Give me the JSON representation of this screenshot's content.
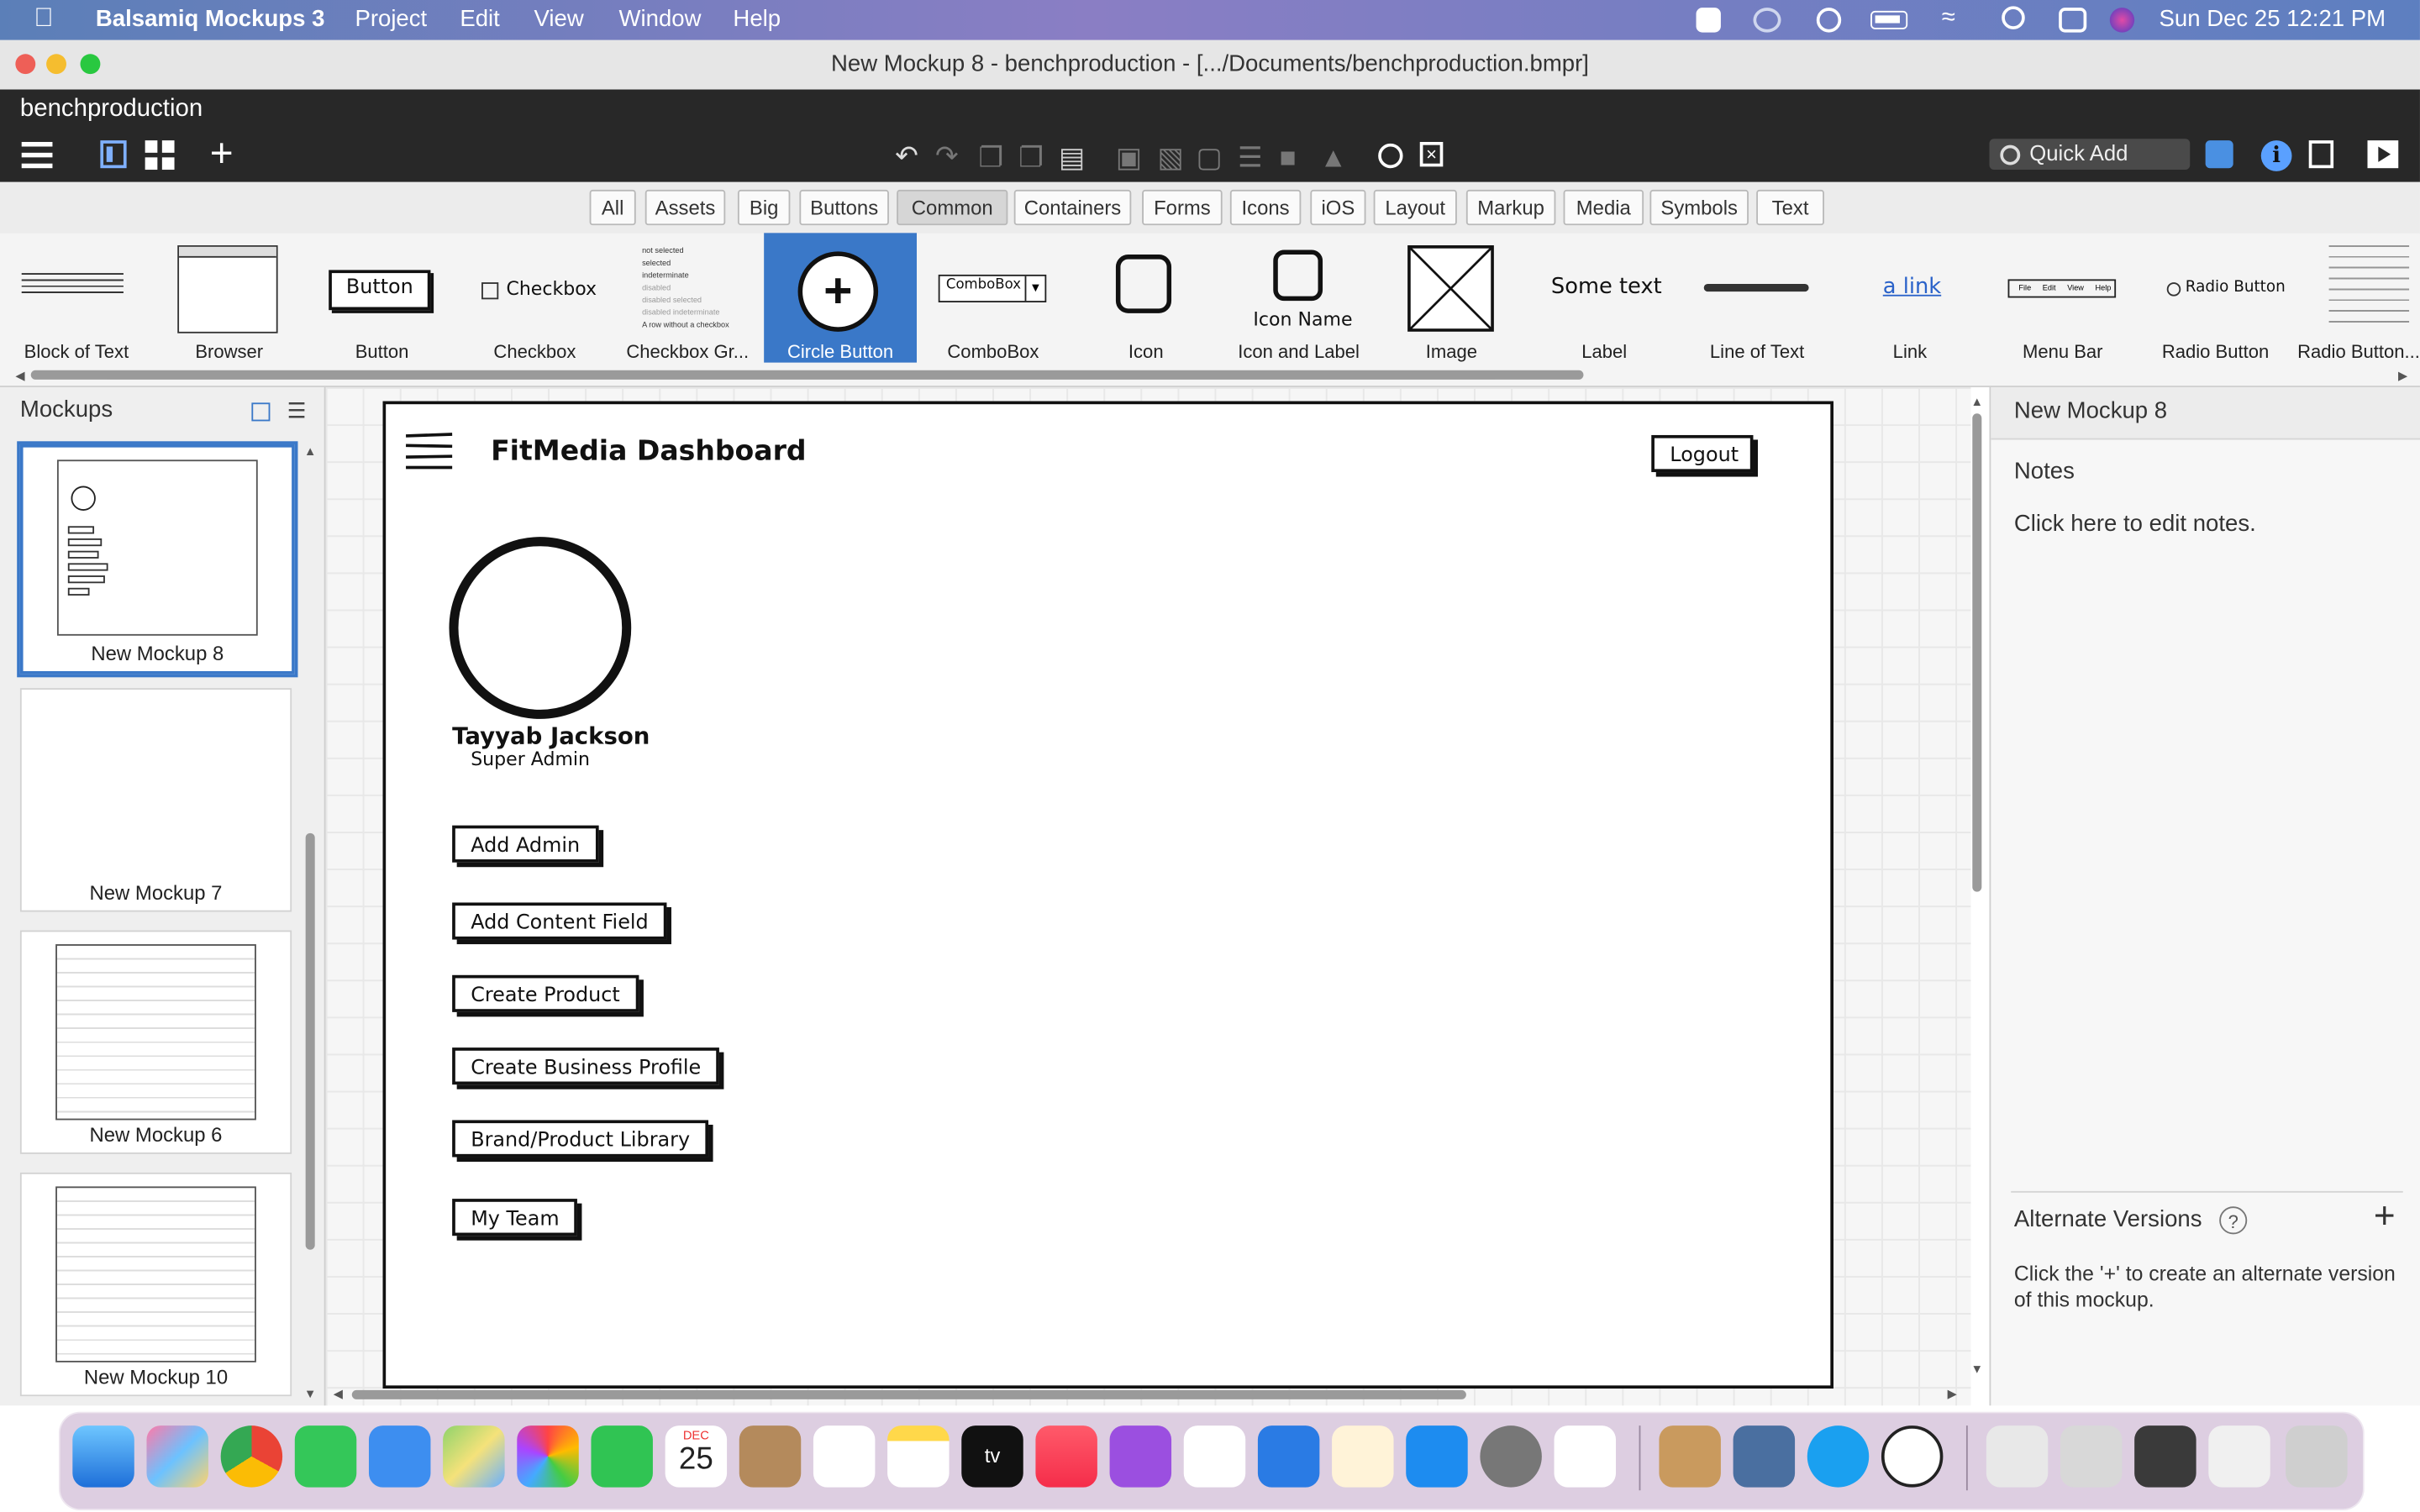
{
  "menubar": {
    "apple": "",
    "app_name": "Balsamiq Mockups 3",
    "items": [
      "Project",
      "Edit",
      "View",
      "Window",
      "Help"
    ],
    "clock": "Sun Dec 25  12:21 PM"
  },
  "window": {
    "title": "New Mockup 8 - benchproduction - [.../Documents/benchproduction.bmpr]",
    "project_name": "benchproduction"
  },
  "toolbar": {
    "quick_add_placeholder": "Quick Add"
  },
  "filter_tabs": [
    "All",
    "Assets",
    "Big",
    "Buttons",
    "Common",
    "Containers",
    "Forms",
    "Icons",
    "iOS",
    "Layout",
    "Markup",
    "Media",
    "Symbols",
    "Text"
  ],
  "filter_active": "Common",
  "library": {
    "items": [
      "Block of Text",
      "Browser",
      "Button",
      "Checkbox",
      "Checkbox Gr...",
      "Circle Button",
      "ComboBox",
      "Icon",
      "Icon and Label",
      "Image",
      "Label",
      "Line of Text",
      "Link",
      "Menu Bar",
      "Radio Button",
      "Radio Button..."
    ],
    "active": "Circle Button",
    "preview_button": "Button",
    "preview_checkbox": "Checkbox",
    "preview_combobox": "ComboBox",
    "preview_icon_name": "Icon Name",
    "preview_label": "Some text",
    "preview_link": "a link",
    "preview_radio": "Radio Button",
    "preview_checkbox_group": [
      "not selected",
      "selected",
      "indeterminate",
      "disabled",
      "disabled selected",
      "disabled indeterminate",
      "A row without a checkbox"
    ],
    "preview_menubar": [
      "File",
      "Edit",
      "View",
      "Help"
    ]
  },
  "mockups_panel": {
    "title": "Mockups",
    "items": [
      "New Mockup 8",
      "New Mockup 7",
      "New Mockup 6",
      "New Mockup 10"
    ],
    "selected": "New Mockup 8"
  },
  "mockup": {
    "title": "FitMedia Dashboard",
    "logout_label": "Logout",
    "user_name": "Tayyab Jackson",
    "user_role": "Super Admin",
    "buttons": [
      "Add Admin",
      "Add Content Field",
      "Create Product",
      "Create Business Profile",
      "Brand/Product Library",
      "My Team"
    ]
  },
  "inspector": {
    "title": "New Mockup 8",
    "notes_label": "Notes",
    "notes_placeholder": "Click here to edit notes.",
    "alt_versions_label": "Alternate Versions",
    "alt_versions_help": "?",
    "alt_versions_hint": "Click the '+' to create an alternate version of this mockup."
  },
  "dock": {
    "date_month": "DEC",
    "date_day": "25",
    "tv_label": "tv"
  },
  "colors": {
    "accent": "#3a78c8",
    "toolbar_bg": "#282828",
    "menubar_bg": "#6c80c0"
  }
}
